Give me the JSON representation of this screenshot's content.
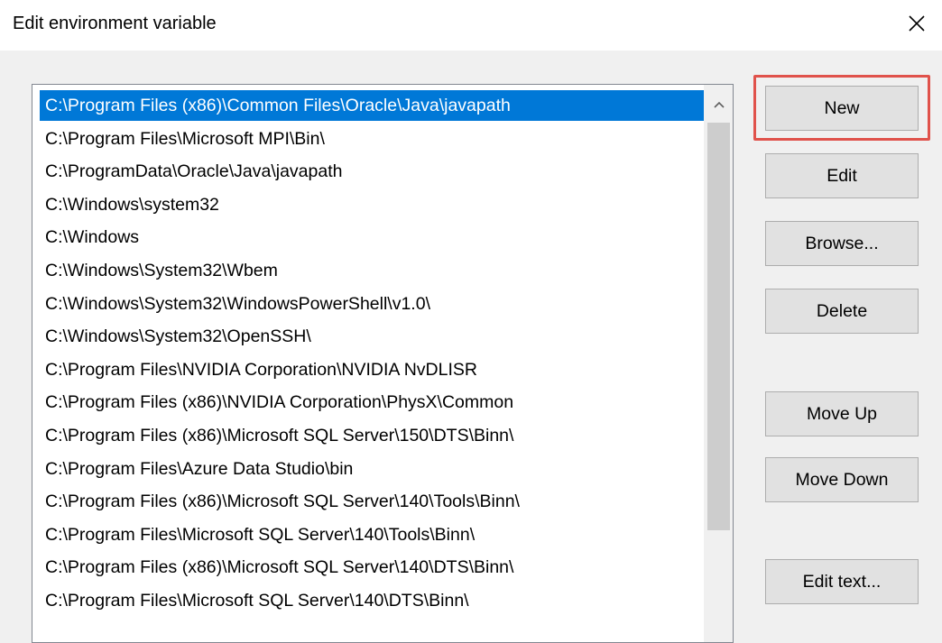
{
  "window": {
    "title": "Edit environment variable"
  },
  "list": {
    "items": [
      "C:\\Program Files (x86)\\Common Files\\Oracle\\Java\\javapath",
      "C:\\Program Files\\Microsoft MPI\\Bin\\",
      "C:\\ProgramData\\Oracle\\Java\\javapath",
      "C:\\Windows\\system32",
      "C:\\Windows",
      "C:\\Windows\\System32\\Wbem",
      "C:\\Windows\\System32\\WindowsPowerShell\\v1.0\\",
      "C:\\Windows\\System32\\OpenSSH\\",
      "C:\\Program Files\\NVIDIA Corporation\\NVIDIA NvDLISR",
      "C:\\Program Files (x86)\\NVIDIA Corporation\\PhysX\\Common",
      "C:\\Program Files (x86)\\Microsoft SQL Server\\150\\DTS\\Binn\\",
      "C:\\Program Files\\Azure Data Studio\\bin",
      "C:\\Program Files (x86)\\Microsoft SQL Server\\140\\Tools\\Binn\\",
      "C:\\Program Files\\Microsoft SQL Server\\140\\Tools\\Binn\\",
      "C:\\Program Files (x86)\\Microsoft SQL Server\\140\\DTS\\Binn\\",
      "C:\\Program Files\\Microsoft SQL Server\\140\\DTS\\Binn\\"
    ],
    "selected_index": 0
  },
  "buttons": {
    "new": "New",
    "edit": "Edit",
    "browse": "Browse...",
    "delete": "Delete",
    "move_up": "Move Up",
    "move_down": "Move Down",
    "edit_text": "Edit text..."
  },
  "icons": {
    "close": "close-icon",
    "scroll_up": "chevron-up-icon"
  },
  "colors": {
    "selection": "#0078d7",
    "highlight": "#e0524b"
  }
}
